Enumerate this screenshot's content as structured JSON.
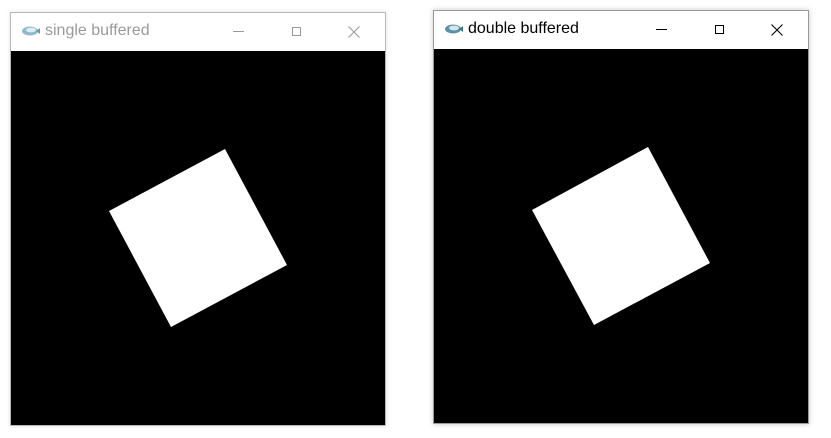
{
  "windows": [
    {
      "title": "single buffered",
      "focused": false,
      "canvas_background": "#000000",
      "shape_color": "#ffffff",
      "shape": "rotated-square"
    },
    {
      "title": "double buffered",
      "focused": true,
      "canvas_background": "#000000",
      "shape_color": "#ffffff",
      "shape": "rotated-square"
    }
  ],
  "icons": {
    "app": "app-icon",
    "minimize": "minimize-icon",
    "maximize": "maximize-icon",
    "close": "close-icon"
  }
}
